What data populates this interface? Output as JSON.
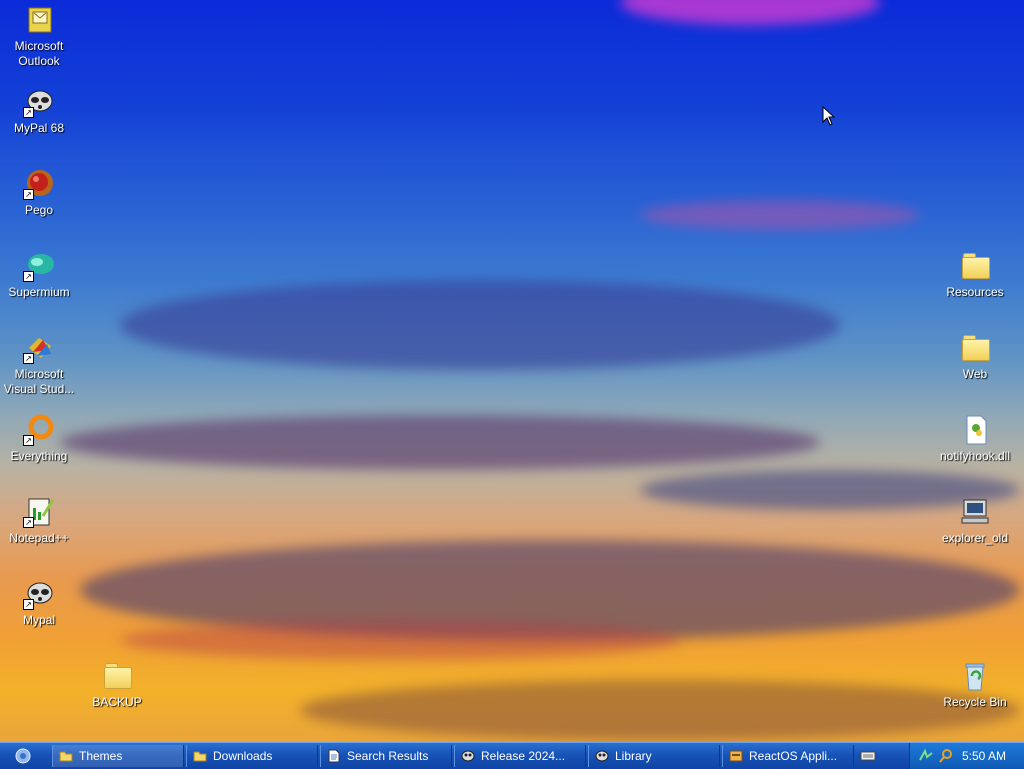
{
  "desktop": {
    "icons_left": [
      {
        "label1": "Microsoft",
        "label2": "Outlook",
        "icon": "outlook-icon"
      },
      {
        "label1": "MyPal 68",
        "label2": "",
        "icon": "mypal-icon"
      },
      {
        "label1": "Pego",
        "label2": "",
        "icon": "pego-icon"
      },
      {
        "label1": "Supermium",
        "label2": "",
        "icon": "supermium-icon"
      },
      {
        "label1": "Microsoft",
        "label2": "Visual Stud...",
        "icon": "visual-studio-icon"
      },
      {
        "label1": "Everything",
        "label2": "",
        "icon": "everything-icon"
      },
      {
        "label1": "Notepad++",
        "label2": "",
        "icon": "notepadpp-icon"
      },
      {
        "label1": "Mypal",
        "label2": "",
        "icon": "mypal-icon"
      },
      {
        "label1": "BACKUP",
        "label2": "",
        "icon": "folder-icon"
      }
    ],
    "icons_right": [
      {
        "label1": "Resources",
        "icon": "folder-icon"
      },
      {
        "label1": "Web",
        "icon": "folder-icon"
      },
      {
        "label1": "notifyhook.dll",
        "icon": "dll-file-icon"
      },
      {
        "label1": "explorer_old",
        "icon": "computer-icon"
      },
      {
        "label1": "Recycle Bin",
        "icon": "recycle-bin-icon"
      }
    ]
  },
  "taskbar": {
    "tasks": [
      {
        "label": "Themes",
        "icon": "folder-icon"
      },
      {
        "label": "Downloads",
        "icon": "folder-icon"
      },
      {
        "label": "Search Results",
        "icon": "document-icon"
      },
      {
        "label": "Release 2024...",
        "icon": "mypal-icon"
      },
      {
        "label": "Library",
        "icon": "mypal-icon"
      },
      {
        "label": "ReactOS Appli...",
        "icon": "app-icon"
      }
    ],
    "clock": "5:50 AM"
  },
  "colors": {
    "taskbar": "#1853b8",
    "tray": "#0f5ab5"
  }
}
